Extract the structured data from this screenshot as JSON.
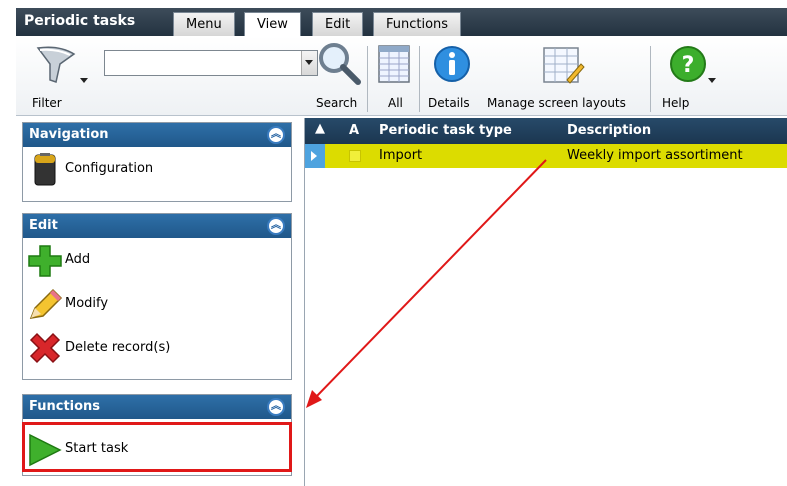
{
  "app": {
    "title": "Periodic tasks"
  },
  "tabs": [
    {
      "label": "Menu"
    },
    {
      "label": "View"
    },
    {
      "label": "Edit"
    },
    {
      "label": "Functions"
    }
  ],
  "toolbar": {
    "filter_label": "Filter",
    "search_label": "Search",
    "all_label": "All",
    "details_label": "Details",
    "layouts_label": "Manage screen layouts",
    "help_label": "Help",
    "filter_value": ""
  },
  "panels": {
    "navigation": {
      "title": "Navigation",
      "items": [
        {
          "label": "Configuration"
        }
      ]
    },
    "edit": {
      "title": "Edit",
      "items": [
        {
          "label": "Add"
        },
        {
          "label": "Modify"
        },
        {
          "label": "Delete record(s)"
        }
      ]
    },
    "functions": {
      "title": "Functions",
      "items": [
        {
          "label": "Start task"
        }
      ]
    }
  },
  "grid": {
    "columns": {
      "a": "A",
      "type": "Periodic task type",
      "description": "Description"
    },
    "rows": [
      {
        "type": "Import",
        "description": "Weekly import assortiment"
      }
    ]
  },
  "colors": {
    "accent": "#20588a",
    "selected_row": "#dcdc00",
    "highlight": "#e01818"
  }
}
